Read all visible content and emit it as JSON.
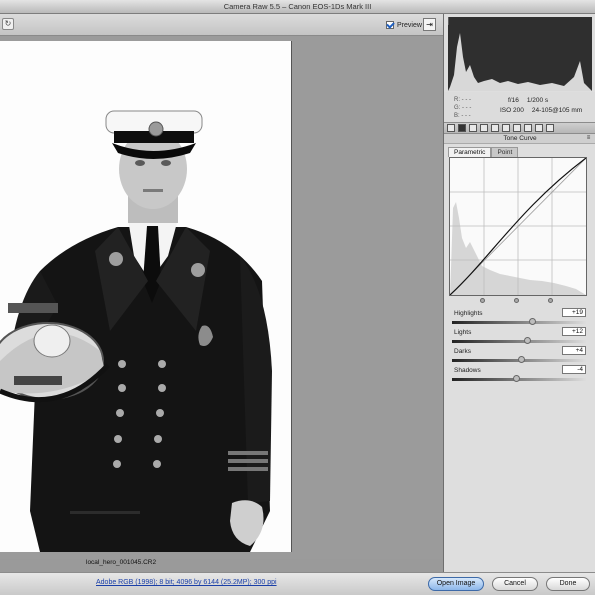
{
  "window": {
    "title": "Camera Raw 5.5  –  Canon EOS-1Ds Mark III"
  },
  "toolbar": {
    "preview_label": "Preview",
    "preview_checked": true
  },
  "image": {
    "filename": "local_hero_001045.CR2"
  },
  "info": {
    "rgb_labels": [
      "R:",
      "G:",
      "B:"
    ],
    "rgb_values": [
      "- - -",
      "- - -",
      "- - -"
    ],
    "aperture": "f/16",
    "shutter": "1/200 s",
    "iso": "ISO 200",
    "lens": "24-105@105 mm"
  },
  "panel": {
    "section_title": "Tone Curve",
    "tabs": [
      "Parametric",
      "Point"
    ],
    "active_tab": "Parametric"
  },
  "sliders": [
    {
      "label": "Highlights",
      "value": "+19",
      "level": 0.6
    },
    {
      "label": "Lights",
      "value": "+12",
      "level": 0.56
    },
    {
      "label": "Darks",
      "value": "+4",
      "level": 0.52
    },
    {
      "label": "Shadows",
      "value": "-4",
      "level": 0.48
    }
  ],
  "footer": {
    "workflow_link": "Adobe RGB (1998); 8 bit; 4096 by 6144 (25.2MP); 300 ppi",
    "open_label": "Open Image",
    "cancel_label": "Cancel",
    "done_label": "Done"
  },
  "colors": {
    "accent": "#1f5fbf",
    "link": "#1a3fa8"
  }
}
